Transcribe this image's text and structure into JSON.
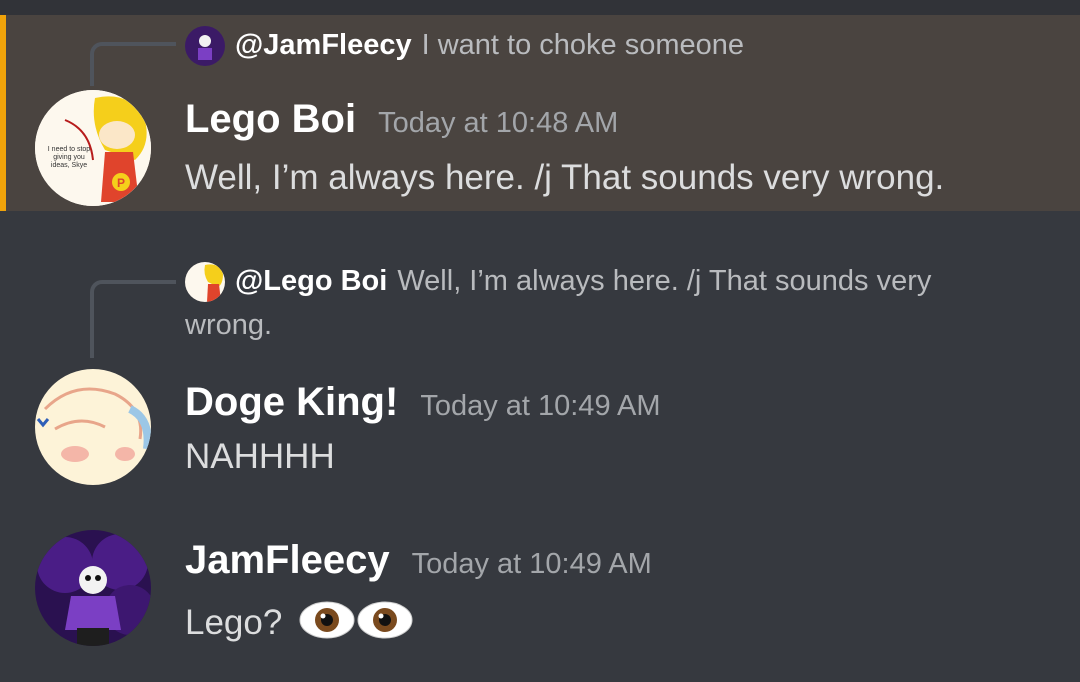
{
  "messages": [
    {
      "reply": {
        "name": "@JamFleecy",
        "text": "I want to choke someone"
      },
      "author": "Lego Boi",
      "time": "Today at 10:48 AM",
      "text": "Well, I’m always here. /j That sounds very wrong.",
      "avatar_text": [
        "I need to stop",
        "giving you",
        "ideas, Skye"
      ],
      "highlighted": true
    },
    {
      "reply": {
        "name": "@Lego Boi",
        "text": "Well, I’m always here. /j That sounds very",
        "text_cont": "wrong."
      },
      "author": "Doge King!",
      "time": "Today at 10:49 AM",
      "text": "NAHHHH"
    },
    {
      "author": "JamFleecy",
      "time": "Today at 10:49 AM",
      "text": "Lego?",
      "emoji": "eyes-emoji"
    }
  ],
  "colors": {
    "background": "#36393f",
    "highlight": "#4a4440",
    "highlight_bar": "#f0a30a",
    "username": "#ffffff",
    "timestamp": "#a3a6aa",
    "text": "#dcddde"
  }
}
